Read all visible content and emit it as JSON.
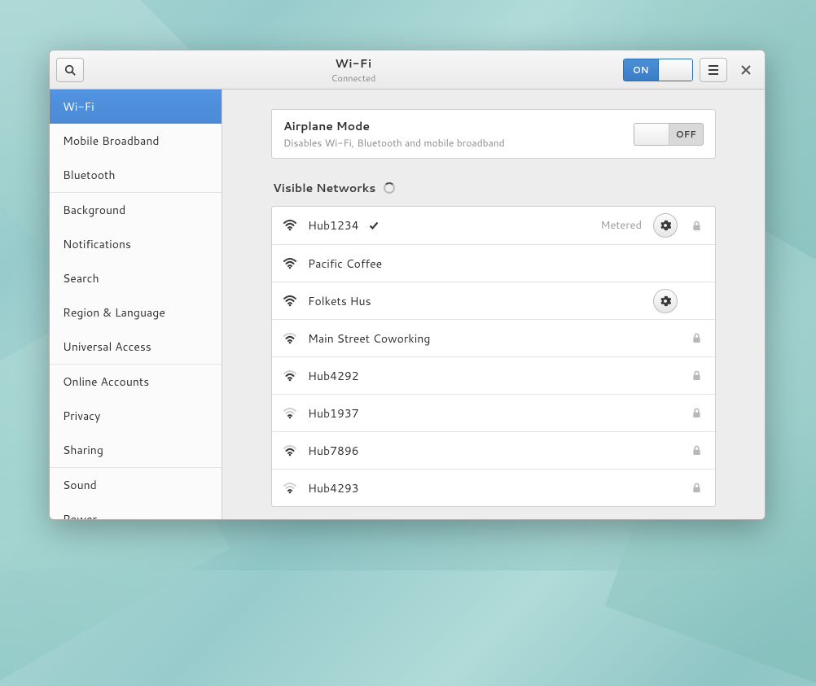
{
  "header": {
    "title": "Wi-Fi",
    "subtitle": "Connected",
    "wifi_switch": {
      "state": "on",
      "on_label": "ON"
    }
  },
  "sidebar": {
    "items": [
      {
        "label": "Wi-Fi",
        "selected": true,
        "group_end": false
      },
      {
        "label": "Mobile Broadband",
        "selected": false,
        "group_end": false
      },
      {
        "label": "Bluetooth",
        "selected": false,
        "group_end": true
      },
      {
        "label": "Background",
        "selected": false,
        "group_end": false
      },
      {
        "label": "Notifications",
        "selected": false,
        "group_end": false
      },
      {
        "label": "Search",
        "selected": false,
        "group_end": false
      },
      {
        "label": "Region & Language",
        "selected": false,
        "group_end": false
      },
      {
        "label": "Universal Access",
        "selected": false,
        "group_end": true
      },
      {
        "label": "Online Accounts",
        "selected": false,
        "group_end": false
      },
      {
        "label": "Privacy",
        "selected": false,
        "group_end": false
      },
      {
        "label": "Sharing",
        "selected": false,
        "group_end": true
      },
      {
        "label": "Sound",
        "selected": false,
        "group_end": false
      },
      {
        "label": "Power",
        "selected": false,
        "group_end": false
      }
    ]
  },
  "airplane": {
    "title": "Airplane Mode",
    "subtitle": "Disables Wi-Fi, Bluetooth and mobile broadband",
    "switch": {
      "state": "off",
      "off_label": "OFF"
    }
  },
  "networks": {
    "section_title": "Visible Networks",
    "loading": true,
    "items": [
      {
        "name": "Hub1234",
        "connected": true,
        "metered_label": "Metered",
        "has_settings": true,
        "locked": true,
        "signal": 3
      },
      {
        "name": "Pacific Coffee",
        "connected": false,
        "metered_label": "",
        "has_settings": false,
        "locked": false,
        "signal": 3
      },
      {
        "name": "Folkets Hus",
        "connected": false,
        "metered_label": "",
        "has_settings": true,
        "locked": false,
        "signal": 3
      },
      {
        "name": "Main Street Coworking",
        "connected": false,
        "metered_label": "",
        "has_settings": false,
        "locked": true,
        "signal": 2
      },
      {
        "name": "Hub4292",
        "connected": false,
        "metered_label": "",
        "has_settings": false,
        "locked": true,
        "signal": 2
      },
      {
        "name": "Hub1937",
        "connected": false,
        "metered_label": "",
        "has_settings": false,
        "locked": true,
        "signal": 1
      },
      {
        "name": "Hub7896",
        "connected": false,
        "metered_label": "",
        "has_settings": false,
        "locked": true,
        "signal": 2
      },
      {
        "name": "Hub4293",
        "connected": false,
        "metered_label": "",
        "has_settings": false,
        "locked": true,
        "signal": 1
      }
    ]
  }
}
